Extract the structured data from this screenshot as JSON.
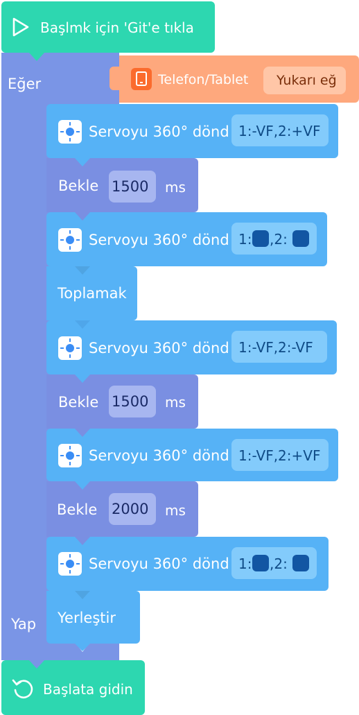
{
  "hat": {
    "label": "Başlmk için 'Git'e tıkla",
    "icon": "play-icon"
  },
  "if_block": {
    "label": "Eğer",
    "do_label": "Yap"
  },
  "condition": {
    "label": "Telefon/Tablet",
    "value": "Yukarı eğ",
    "icon": "tablet-icon"
  },
  "blocks": [
    {
      "type": "servo",
      "label": "Servoyu 360° dönd",
      "value": "1:-VF,2:+VF",
      "icon": "servo-icon"
    },
    {
      "type": "wait",
      "label": "Bekle",
      "value": "1500",
      "unit": "ms"
    },
    {
      "type": "servo",
      "label": "Servoyu 360° dönd",
      "value_p1": "1:",
      "value_p2": ",2:",
      "icon": "servo-icon"
    },
    {
      "type": "action",
      "label": "Toplamak"
    },
    {
      "type": "servo",
      "label": "Servoyu 360° dönd",
      "value": "1:-VF,2:-VF",
      "icon": "servo-icon"
    },
    {
      "type": "wait",
      "label": "Bekle",
      "value": "1500",
      "unit": "ms"
    },
    {
      "type": "servo",
      "label": "Servoyu 360° dönd",
      "value": "1:-VF,2:+VF",
      "icon": "servo-icon"
    },
    {
      "type": "wait",
      "label": "Bekle",
      "value": "2000",
      "unit": "ms"
    },
    {
      "type": "servo",
      "label": "Servoyu 360° dönd",
      "value_p1": "1:",
      "value_p2": ",2:",
      "icon": "servo-icon"
    },
    {
      "type": "action",
      "label": "Yerleştir"
    }
  ],
  "footer": {
    "label": "Başlata gidin",
    "icon": "restart-icon"
  },
  "colors": {
    "teal": "#2dd7b0",
    "if_purple": "#7a95e6",
    "servo_blue": "#56b2f6",
    "wait_indigo": "#7a8fe2",
    "condition_orange": "#fea87d",
    "dot_blue": "#1256a3"
  }
}
